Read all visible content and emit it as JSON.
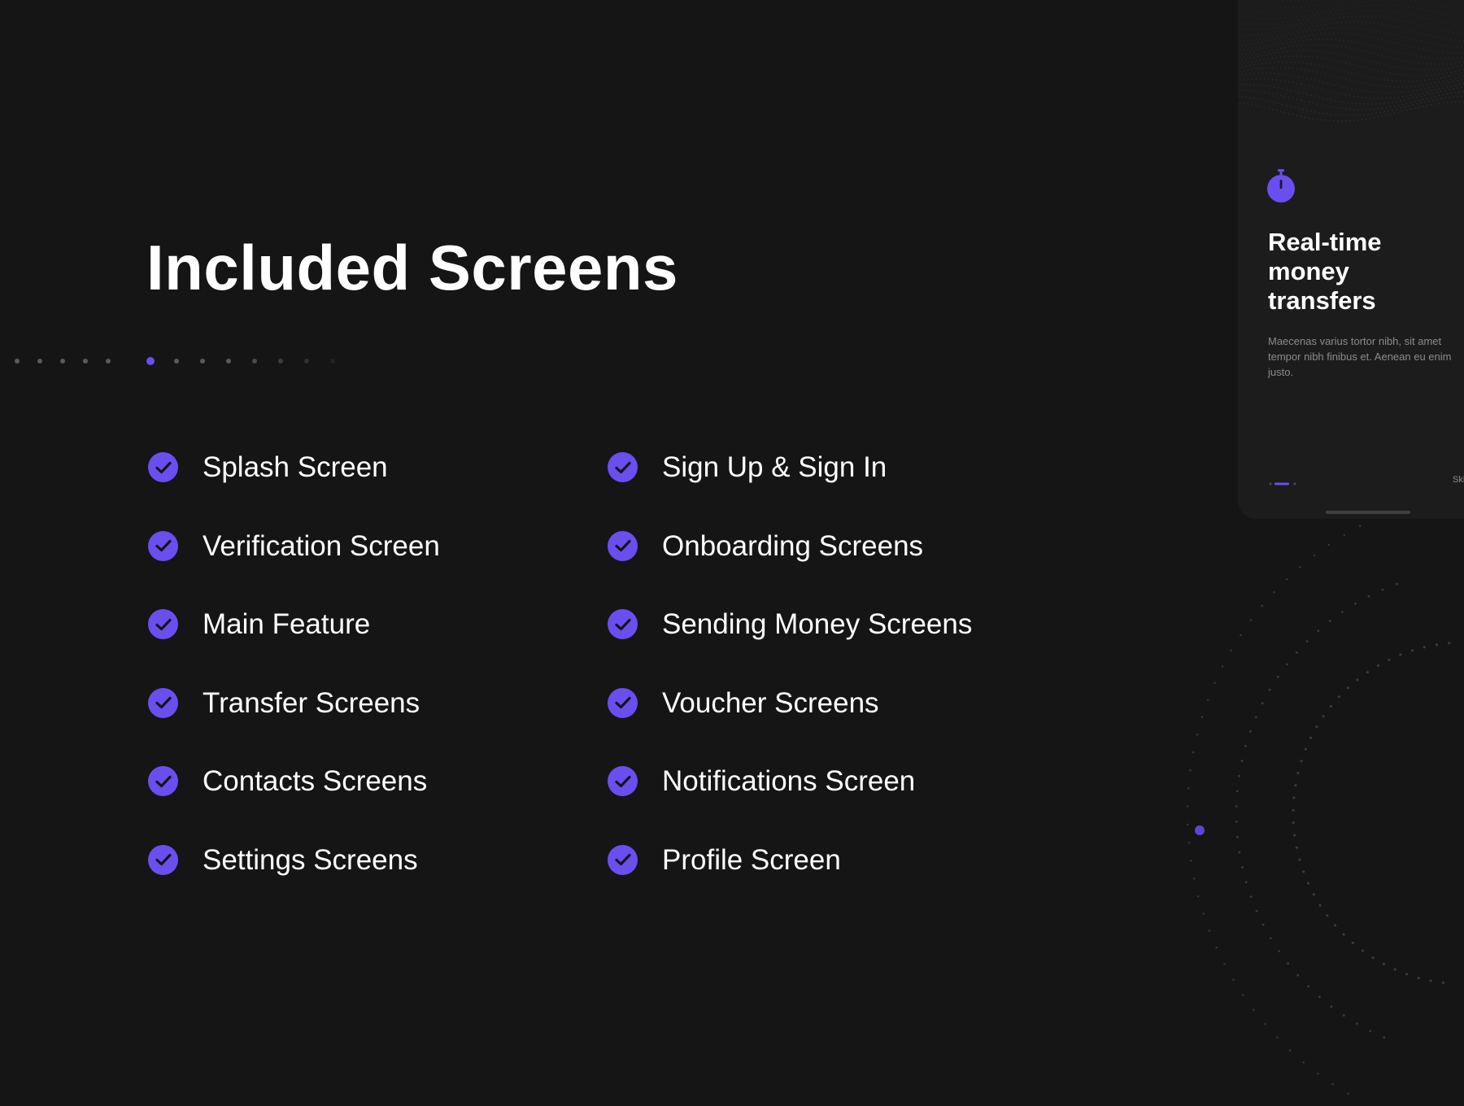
{
  "page": {
    "title": "Included Screens"
  },
  "pager": {
    "dot_count": 13,
    "active_index": 5
  },
  "features": {
    "left": [
      {
        "label": "Splash Screen"
      },
      {
        "label": "Verification Screen"
      },
      {
        "label": "Main Feature"
      },
      {
        "label": "Transfer Screens"
      },
      {
        "label": "Contacts Screens"
      },
      {
        "label": "Settings Screens"
      }
    ],
    "right": [
      {
        "label": "Sign Up & Sign In"
      },
      {
        "label": "Onboarding Screens"
      },
      {
        "label": "Sending Money Screens"
      },
      {
        "label": "Voucher Screens"
      },
      {
        "label": "Notifications Screen"
      },
      {
        "label": "Profile Screen"
      }
    ],
    "icon": "check-circle-icon"
  },
  "phone_preview": {
    "icon": "stopwatch-icon",
    "heading": "Real-time money transfers",
    "body": "Maecenas varius tortor nibh, sit amet tempor nibh finibus et. Aenean eu enim justo.",
    "skip_label": "Skip"
  },
  "colors": {
    "background": "#151515",
    "accent": "#6a4ef0",
    "text": "#ffffff",
    "muted_text": "#8c8c8c",
    "phone_surface": "#1c1c1d"
  }
}
